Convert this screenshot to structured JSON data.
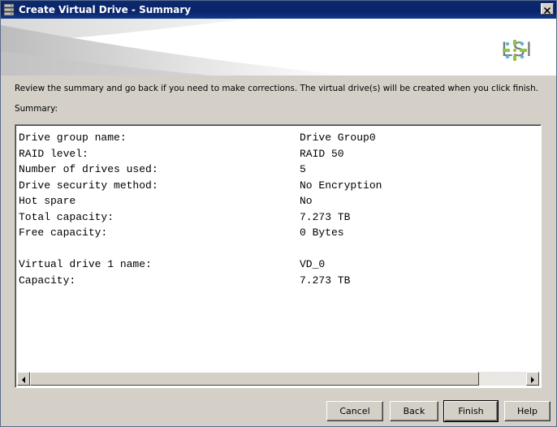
{
  "window": {
    "title": "Create Virtual Drive - Summary"
  },
  "banner": {
    "logo_text": "LSI"
  },
  "instructions": "Review the summary and go back if you need to make corrections. The virtual drive(s) will be created when you click finish.",
  "summary_label": "Summary:",
  "summary_rows": [
    {
      "key": "Drive group name:",
      "value": "Drive Group0"
    },
    {
      "key": "RAID level:",
      "value": "RAID 50"
    },
    {
      "key": "Number of drives used:",
      "value": "5"
    },
    {
      "key": "Drive security method:",
      "value": "No Encryption"
    },
    {
      "key": "Hot spare",
      "value": "No"
    },
    {
      "key": "Total capacity:",
      "value": "7.273 TB"
    },
    {
      "key": "Free capacity:",
      "value": "0 Bytes"
    },
    {
      "key": "",
      "value": ""
    },
    {
      "key": "Virtual drive 1 name:",
      "value": "VD_0"
    },
    {
      "key": "Capacity:",
      "value": "7.273 TB"
    }
  ],
  "buttons": {
    "cancel": "Cancel",
    "back": "Back",
    "finish": "Finish",
    "help": "Help"
  },
  "colors": {
    "title_bar": "#0a246a",
    "dialog_bg": "#d4d0c8",
    "logo_gray": "#7a7a7a",
    "logo_accent": "#8cc63f"
  },
  "icons": {
    "title": "drive-stack-icon",
    "close": "close-icon",
    "logo": "lsi-logo-icon",
    "scroll_left": "arrow-left-icon",
    "scroll_right": "arrow-right-icon"
  }
}
